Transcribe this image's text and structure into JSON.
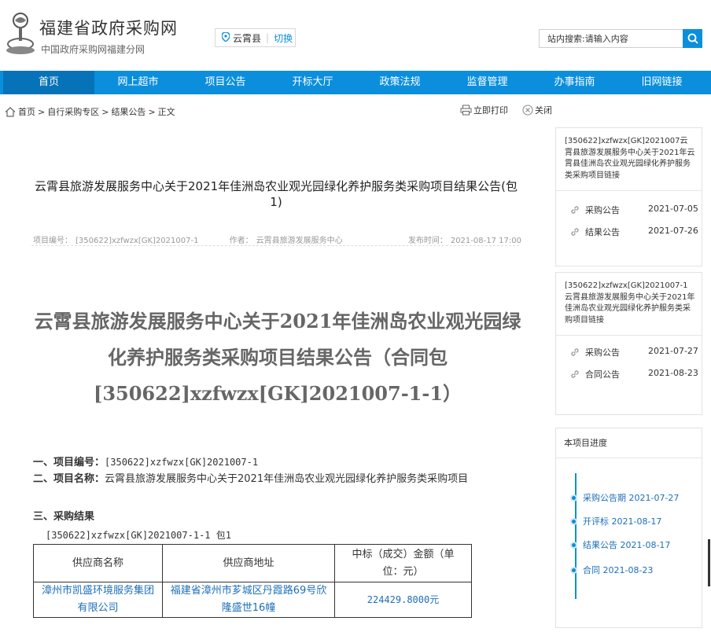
{
  "header": {
    "site_title": "福建省政府采购网",
    "site_subtitle": "中国政府采购网福建分网",
    "location": "云霄县",
    "switch_label": "切换",
    "search_label": "站内搜索:",
    "search_placeholder": "请输入内容"
  },
  "nav": [
    {
      "label": "首页"
    },
    {
      "label": "网上超市"
    },
    {
      "label": "项目公告"
    },
    {
      "label": "开标大厅"
    },
    {
      "label": "政策法规"
    },
    {
      "label": "监督管理"
    },
    {
      "label": "办事指南"
    },
    {
      "label": "旧网链接"
    }
  ],
  "breadcrumb": [
    "首页",
    "自行采购专区",
    "结果公告",
    "正文"
  ],
  "tools": {
    "print": "立即打印",
    "close": "关闭"
  },
  "article": {
    "title": "云霄县旅游发展服务中心关于2021年佳洲岛农业观光园绿化养护服务类采购项目结果公告(包1)",
    "meta_code_label": "项目编号：",
    "meta_code": "[350622]xzfwzx[GK]2021007-1",
    "meta_author_label": "作者：",
    "meta_author": "云霄县旅游发展服务中心",
    "meta_time_label": "发布时间：",
    "meta_time": "2021-08-17 17:00",
    "big_title": "云霄县旅游发展服务中心关于2021年佳洲岛农业观光园绿化养护服务类采购项目结果公告（合同包[350622]xzfwzx[GK]2021007-1-1）",
    "sec1_label": "一、项目编号：",
    "sec1_value": "[350622]xzfwzx[GK]2021007-1",
    "sec2_label": "二、项目名称：",
    "sec2_value": "云霄县旅游发展服务中心关于2021年佳洲岛农业观光园绿化养护服务类采购项目",
    "sec3_label": "三、采购结果",
    "package_line": "[350622]xzfwzx[GK]2021007-1-1 包1",
    "table": {
      "headers": [
        "供应商名称",
        "供应商地址",
        "中标（成交）金额（单位：元）"
      ],
      "rows": [
        [
          "漳州市凯盛环境服务集团有限公司",
          "福建省漳州市芗城区丹霞路69号欣隆盛世16幢",
          "224429.8000元"
        ]
      ]
    }
  },
  "sidebar": {
    "box1": {
      "title": "[350622]xzfwzx[GK]2021007云霄县旅游发展服务中心关于2021年云霄县佳洲岛农业观光园绿化养护服务类采购项目链接",
      "items": [
        {
          "name": "采购公告",
          "date": "2021-07-05"
        },
        {
          "name": "结果公告",
          "date": "2021-07-26"
        }
      ]
    },
    "box2": {
      "title": "[350622]xzfwzx[GK]2021007-1云霄县旅游发展服务中心关于2021年佳洲岛农业观光园绿化养护服务类采购项目链接",
      "items": [
        {
          "name": "采购公告",
          "date": "2021-07-27"
        },
        {
          "name": "合同公告",
          "date": "2021-08-23"
        }
      ]
    },
    "progress": {
      "title": "本项目进度",
      "steps": [
        {
          "label": "采购公告期 2021-07-27"
        },
        {
          "label": "开评标 2021-08-17"
        },
        {
          "label": "结果公告 2021-08-17"
        },
        {
          "label": "合同 2021-08-23"
        }
      ]
    }
  },
  "colors": {
    "brand_blue": "#0b8fdc",
    "nav_active": "#0673b8",
    "link_blue": "#1d6fb8"
  }
}
